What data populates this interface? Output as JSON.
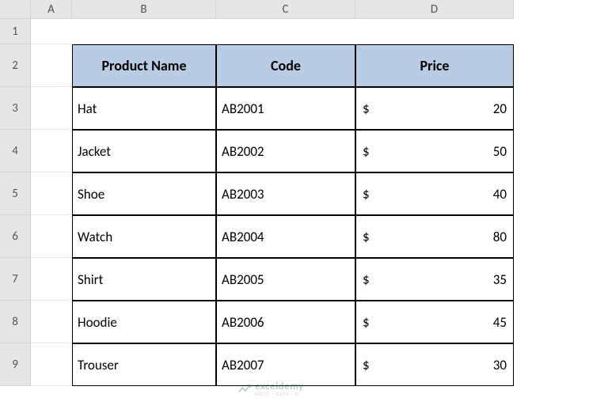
{
  "columns": [
    "",
    "A",
    "B",
    "C",
    "D"
  ],
  "rows": [
    "1",
    "2",
    "3",
    "4",
    "5",
    "6",
    "7",
    "8",
    "9"
  ],
  "headers": {
    "product": "Product Name",
    "code": "Code",
    "price": "Price"
  },
  "data": [
    {
      "product": "Hat",
      "code": "AB2001",
      "currency": "$",
      "price": "20"
    },
    {
      "product": "Jacket",
      "code": "AB2002",
      "currency": "$",
      "price": "50"
    },
    {
      "product": "Shoe",
      "code": "AB2003",
      "currency": "$",
      "price": "40"
    },
    {
      "product": "Watch",
      "code": "AB2004",
      "currency": "$",
      "price": "80"
    },
    {
      "product": "Shirt",
      "code": "AB2005",
      "currency": "$",
      "price": "35"
    },
    {
      "product": "Hoodie",
      "code": "AB2006",
      "currency": "$",
      "price": "45"
    },
    {
      "product": "Trouser",
      "code": "AB2007",
      "currency": "$",
      "price": "30"
    }
  ],
  "watermark": {
    "main": "exceldemy",
    "sub": "EXCEL · DATA · BI"
  }
}
